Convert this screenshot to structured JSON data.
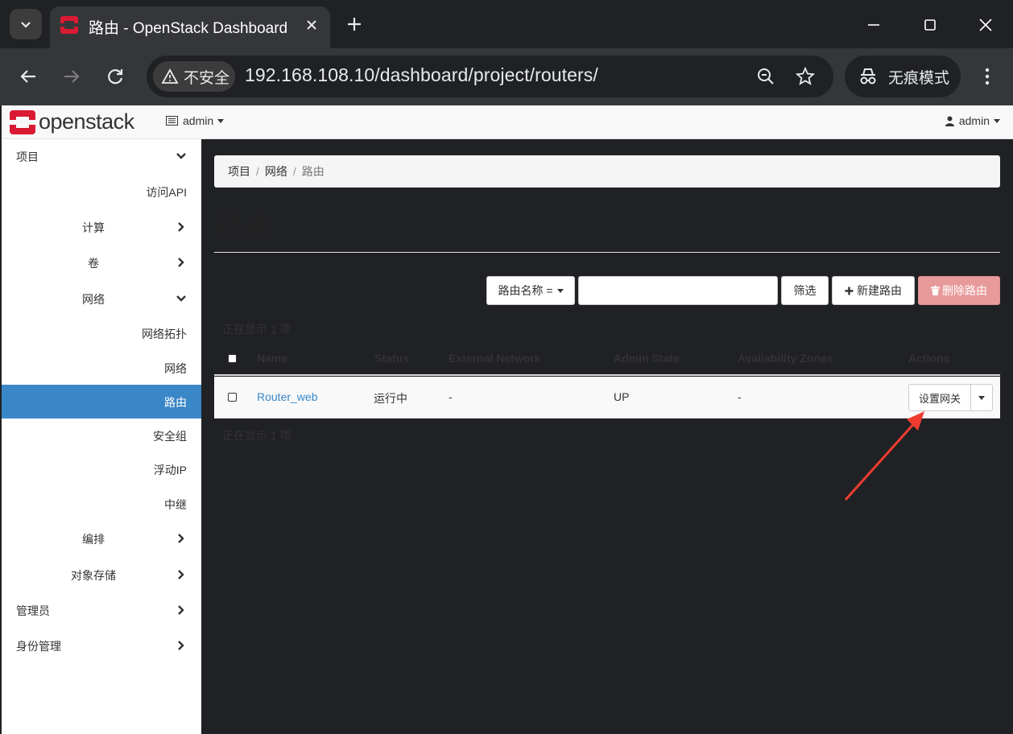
{
  "browser": {
    "tab_title": "路由 - OpenStack Dashboard",
    "security_label": "不安全",
    "url": "192.168.108.10/dashboard/project/routers/",
    "incognito_label": "无痕模式"
  },
  "header": {
    "logo_text": "openstack",
    "project_label": "admin",
    "user_label": "admin"
  },
  "sidebar": {
    "items": [
      {
        "label": "项目",
        "expanded": true
      },
      {
        "label": "访问API"
      },
      {
        "label": "计算"
      },
      {
        "label": "卷"
      },
      {
        "label": "网络",
        "expanded": true
      },
      {
        "label": "网络拓扑"
      },
      {
        "label": "网络"
      },
      {
        "label": "路由",
        "active": true
      },
      {
        "label": "安全组"
      },
      {
        "label": "浮动IP"
      },
      {
        "label": "中继"
      },
      {
        "label": "编排"
      },
      {
        "label": "对象存储"
      },
      {
        "label": "管理员"
      },
      {
        "label": "身份管理"
      }
    ]
  },
  "breadcrumb": [
    "项目",
    "网络",
    "路由"
  ],
  "page_title": "路由",
  "filter": {
    "select_label": "路由名称 =",
    "input_value": "",
    "filter_button": "筛选",
    "create_button": "新建路由",
    "delete_button": "删除路由"
  },
  "table": {
    "count_top": "正在显示 1 项",
    "count_bottom": "正在显示 1 项",
    "columns": [
      "Name",
      "Status",
      "External Network",
      "Admin State",
      "Availability Zones",
      "Actions"
    ],
    "rows": [
      {
        "name": "Router_web",
        "status": "运行中",
        "external_network": "-",
        "admin_state": "UP",
        "availability_zones": "-",
        "action": "设置网关"
      }
    ]
  },
  "colors": {
    "accent": "#3a87c8",
    "danger_button": "#e89a9a",
    "brand_red": "#da1a32",
    "annotation_arrow": "#f03c30"
  }
}
